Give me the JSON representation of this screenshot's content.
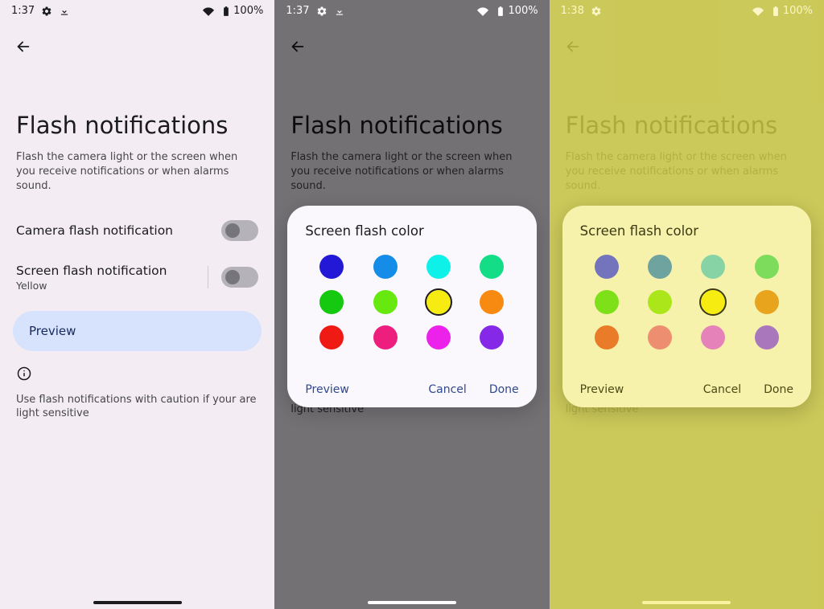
{
  "status": {
    "panel1_time": "1:37",
    "panel2_time": "1:37",
    "panel3_time": "1:38",
    "battery_text": "100%"
  },
  "page": {
    "title": "Flash notifications",
    "description": "Flash the camera light or the screen when you receive notifications or when alarms sound.",
    "camera_label": "Camera flash notification",
    "screen_label": "Screen flash notification",
    "screen_sub": "Yellow",
    "preview_label": "Preview",
    "caution": "Use flash notifications with caution if your are light sensitive"
  },
  "dialog": {
    "title": "Screen flash color",
    "preview": "Preview",
    "cancel": "Cancel",
    "done": "Done",
    "selected_index": 6,
    "colors_p2": [
      "#2218d6",
      "#158de8",
      "#0ef1e9",
      "#14dd87",
      "#15c911",
      "#67e80f",
      "#f6ec11",
      "#f78a11",
      "#ef1a13",
      "#ee1e7e",
      "#ec22ea",
      "#8628e8"
    ],
    "colors_p3": [
      "#7374bb",
      "#6fa39f",
      "#87d3a6",
      "#7edc5c",
      "#7ee018",
      "#aae619",
      "#f6ec11",
      "#e9a41d",
      "#ea7b28",
      "#ec8e6f",
      "#e582ba",
      "#a977bb"
    ]
  }
}
